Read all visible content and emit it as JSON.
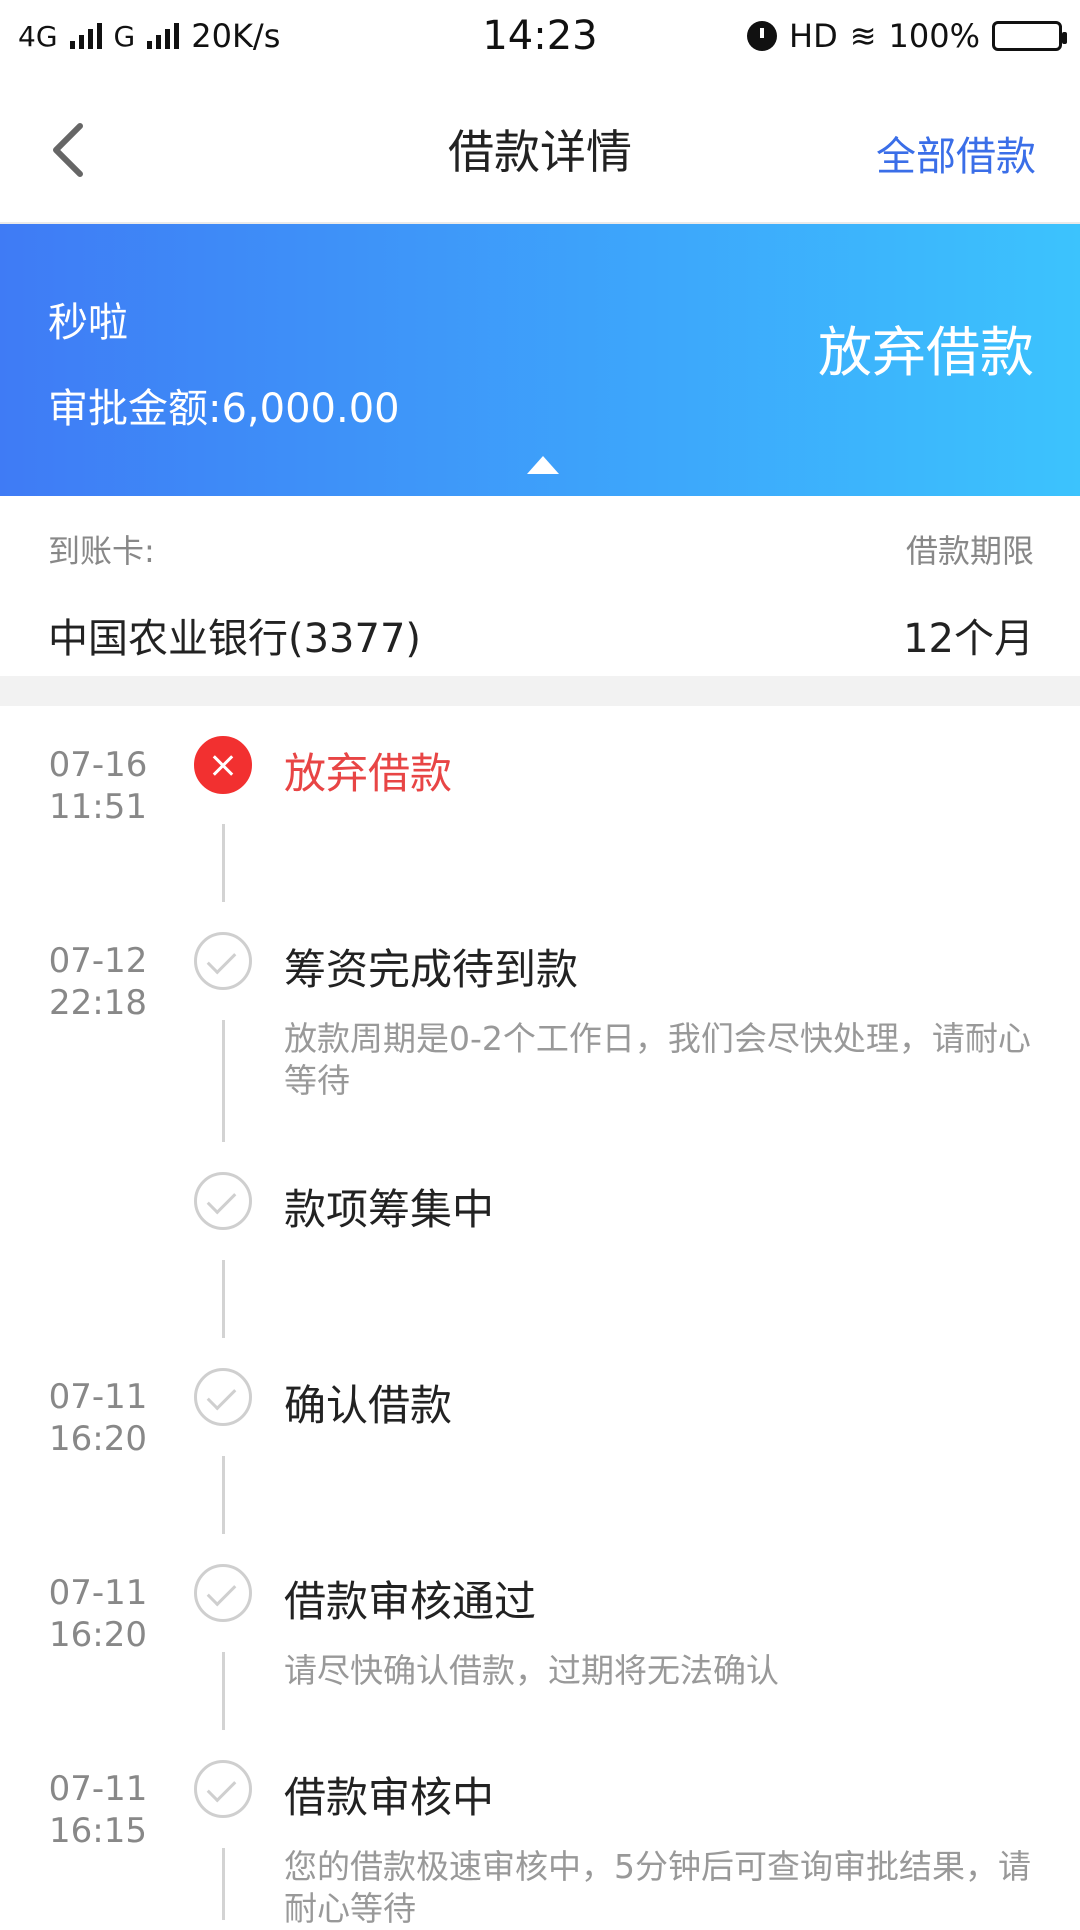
{
  "status_bar": {
    "network1": "4G",
    "network2": "G",
    "speed": "20K/s",
    "time": "14:23",
    "hd": "HD",
    "battery": "100%"
  },
  "nav": {
    "title": "借款详情",
    "right_link": "全部借款"
  },
  "banner": {
    "product": "秒啦",
    "amount_text": "审批金额:6,000.00",
    "status": "放弃借款",
    "colors": {
      "start": "#3f7bf5",
      "end": "#3cc3fd"
    }
  },
  "info": {
    "card_label": "到账卡:",
    "card_value": "中国农业银行(3377)",
    "term_label": "借款期限",
    "term_value": "12个月"
  },
  "timeline": [
    {
      "date": "07-16",
      "time": "11:51",
      "title": "放弃借款",
      "icon": "close-icon",
      "desc": ""
    },
    {
      "date": "07-12",
      "time": "22:18",
      "title": "筹资完成待到款",
      "icon": "check-icon",
      "desc": "放款周期是0-2个工作日，我们会尽快处理，请耐心等待"
    },
    {
      "date": "",
      "time": "",
      "title": "款项筹集中",
      "icon": "check-icon",
      "desc": ""
    },
    {
      "date": "07-11",
      "time": "16:20",
      "title": "确认借款",
      "icon": "check-icon",
      "desc": ""
    },
    {
      "date": "07-11",
      "time": "16:20",
      "title": "借款审核通过",
      "icon": "check-icon",
      "desc": "请尽快确认借款，过期将无法确认"
    },
    {
      "date": "07-11",
      "time": "16:15",
      "title": "借款审核中",
      "icon": "check-icon",
      "desc": "您的借款极速审核中，5分钟后可查询审批结果，请耐心等待"
    }
  ],
  "colors": {
    "link": "#3a6ee8",
    "error": "#e84545",
    "muted": "#888888"
  }
}
